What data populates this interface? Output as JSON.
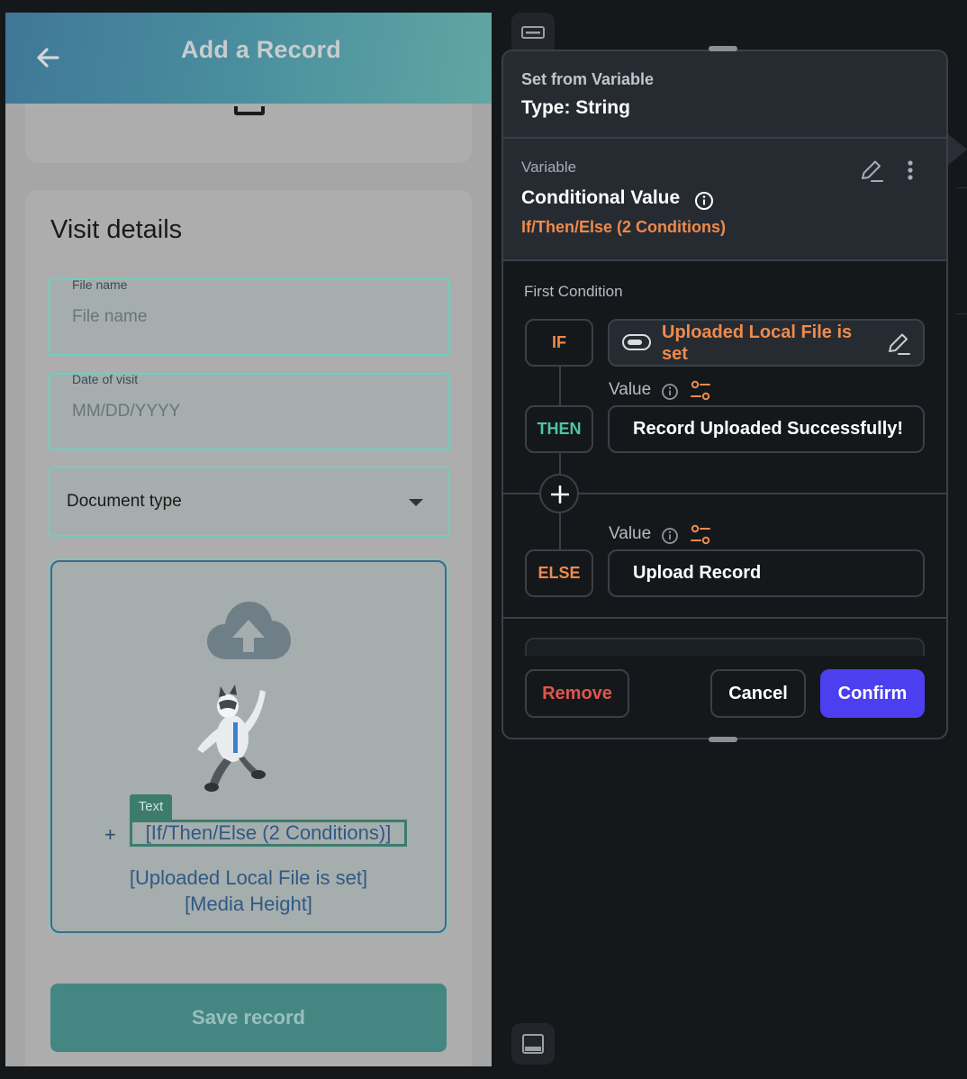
{
  "app": {
    "title": "Add a Record",
    "back_icon": "arrow-left-icon",
    "visit_details_title": "Visit details",
    "fields": [
      {
        "label": "File name",
        "placeholder": "File name"
      },
      {
        "label": "Date of visit",
        "placeholder": "MM/DD/YYYY"
      }
    ],
    "document_type": "Document type",
    "upload": {
      "icon": "cloud-upload-icon",
      "text_badge": "Text",
      "plus": "+",
      "conditional_text": "[If/Then/Else (2 Conditions)]",
      "line1": "[Uploaded Local File is set]",
      "line2": "[Media Height]"
    },
    "save_button": "Save record"
  },
  "panel": {
    "set_from": "Set from Variable",
    "type": "Type: String",
    "variable_label": "Variable",
    "conditional_value": "Conditional Value",
    "condition_summary": "If/Then/Else (2 Conditions)",
    "first_condition": "First Condition",
    "if_label": "IF",
    "if_condition": "Uploaded Local File is set",
    "value_label": "Value",
    "then_label": "THEN",
    "then_value": "Record Uploaded Successfully!",
    "else_label": "ELSE",
    "else_value": "Upload Record",
    "remove": "Remove",
    "cancel": "Cancel",
    "confirm": "Confirm"
  },
  "colors": {
    "accent_orange": "#ef8a4b",
    "accent_teal": "#4ec4a8",
    "confirm_blue": "#4b3ff0",
    "remove_red": "#e0554e"
  }
}
